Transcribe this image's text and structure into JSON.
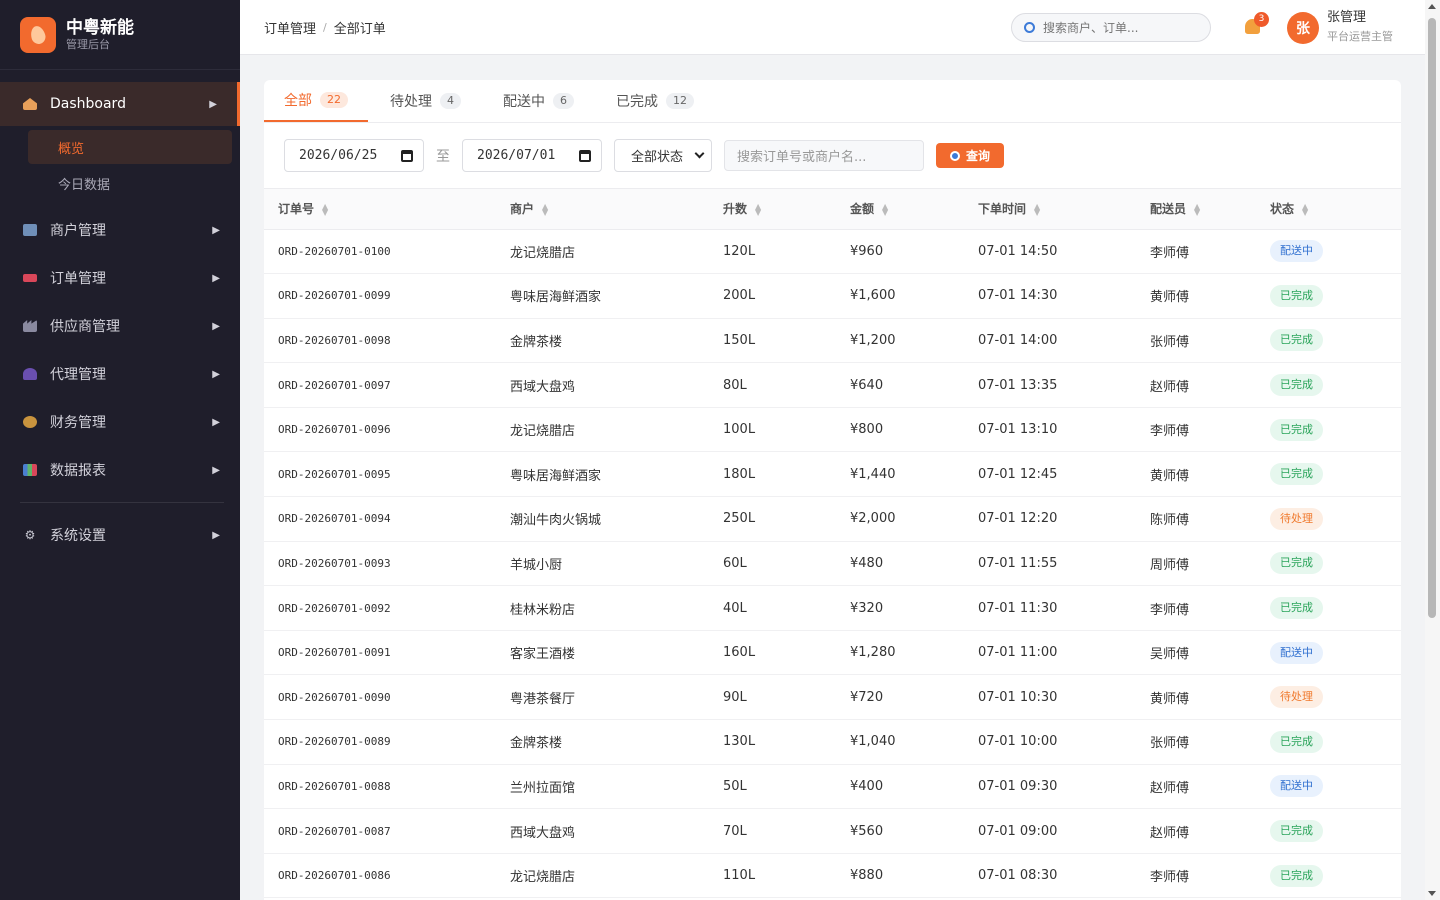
{
  "brand": {
    "name": "中粤新能",
    "subtitle": "管理后台"
  },
  "sidebar": {
    "items": [
      {
        "label": "Dashboard",
        "icon": "home-icon",
        "active": true
      },
      {
        "label": "商户管理",
        "icon": "store-icon"
      },
      {
        "label": "订单管理",
        "icon": "truck-icon"
      },
      {
        "label": "供应商管理",
        "icon": "factory-icon"
      },
      {
        "label": "代理管理",
        "icon": "user-icon"
      },
      {
        "label": "财务管理",
        "icon": "money-bag-icon"
      },
      {
        "label": "数据报表",
        "icon": "bar-chart-icon"
      },
      {
        "label": "系统设置",
        "icon": "gear-icon"
      }
    ],
    "subitems": [
      {
        "label": "概览",
        "active": true
      },
      {
        "label": "今日数据"
      }
    ]
  },
  "header": {
    "breadcrumb": [
      "订单管理",
      "全部订单"
    ],
    "breadcrumb_sep": "/",
    "search_placeholder": "搜索商户、订单...",
    "notification_count": "3",
    "user": {
      "avatar": "张",
      "name": "张管理",
      "role": "平台运营主管"
    }
  },
  "tabs": [
    {
      "label": "全部",
      "count": "22",
      "active": true
    },
    {
      "label": "待处理",
      "count": "4"
    },
    {
      "label": "配送中",
      "count": "6"
    },
    {
      "label": "已完成",
      "count": "12"
    }
  ],
  "filters": {
    "date_from": "2026/06/25",
    "date_to": "2026/07/01",
    "to_text": "至",
    "status_selected": "全部状态",
    "search_placeholder": "搜索订单号或商户名...",
    "query_label": "查询"
  },
  "table": {
    "columns": [
      "订单号",
      "商户",
      "升数",
      "金额",
      "下单时间",
      "配送员",
      "状态"
    ],
    "rows": [
      [
        "ORD-20260701-0100",
        "龙记烧腊店",
        "120L",
        "¥960",
        "07-01 14:50",
        "李师傅",
        "配送中"
      ],
      [
        "ORD-20260701-0099",
        "粤味居海鲜酒家",
        "200L",
        "¥1,600",
        "07-01 14:30",
        "黄师傅",
        "已完成"
      ],
      [
        "ORD-20260701-0098",
        "金牌茶楼",
        "150L",
        "¥1,200",
        "07-01 14:00",
        "张师傅",
        "已完成"
      ],
      [
        "ORD-20260701-0097",
        "西域大盘鸡",
        "80L",
        "¥640",
        "07-01 13:35",
        "赵师傅",
        "已完成"
      ],
      [
        "ORD-20260701-0096",
        "龙记烧腊店",
        "100L",
        "¥800",
        "07-01 13:10",
        "李师傅",
        "已完成"
      ],
      [
        "ORD-20260701-0095",
        "粤味居海鲜酒家",
        "180L",
        "¥1,440",
        "07-01 12:45",
        "黄师傅",
        "已完成"
      ],
      [
        "ORD-20260701-0094",
        "潮汕牛肉火锅城",
        "250L",
        "¥2,000",
        "07-01 12:20",
        "陈师傅",
        "待处理"
      ],
      [
        "ORD-20260701-0093",
        "羊城小厨",
        "60L",
        "¥480",
        "07-01 11:55",
        "周师傅",
        "已完成"
      ],
      [
        "ORD-20260701-0092",
        "桂林米粉店",
        "40L",
        "¥320",
        "07-01 11:30",
        "李师傅",
        "已完成"
      ],
      [
        "ORD-20260701-0091",
        "客家王酒楼",
        "160L",
        "¥1,280",
        "07-01 11:00",
        "吴师傅",
        "配送中"
      ],
      [
        "ORD-20260701-0090",
        "粤港茶餐厅",
        "90L",
        "¥720",
        "07-01 10:30",
        "黄师傅",
        "待处理"
      ],
      [
        "ORD-20260701-0089",
        "金牌茶楼",
        "130L",
        "¥1,040",
        "07-01 10:00",
        "张师傅",
        "已完成"
      ],
      [
        "ORD-20260701-0088",
        "兰州拉面馆",
        "50L",
        "¥400",
        "07-01 09:30",
        "赵师傅",
        "配送中"
      ],
      [
        "ORD-20260701-0087",
        "西域大盘鸡",
        "70L",
        "¥560",
        "07-01 09:00",
        "赵师傅",
        "已完成"
      ],
      [
        "ORD-20260701-0086",
        "龙记烧腊店",
        "110L",
        "¥880",
        "07-01 08:30",
        "李师傅",
        "已完成"
      ]
    ]
  },
  "colors": {
    "accent": "#f26a2e",
    "sidebar_bg": "#1f1e2b",
    "delivering": "#3070d0",
    "done": "#2aa45a",
    "pending": "#f07a2e"
  }
}
